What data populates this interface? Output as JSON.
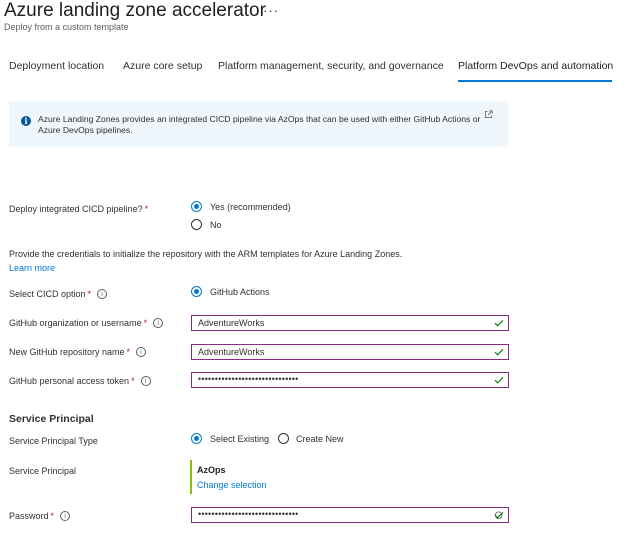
{
  "header": {
    "title": "Azure landing zone accelerator",
    "more_label": "···",
    "subtitle": "Deploy from a custom template"
  },
  "tabs": [
    {
      "label": "Deployment location",
      "active": false
    },
    {
      "label": "Azure core setup",
      "active": false
    },
    {
      "label": "Platform management, security, and governance",
      "active": false
    },
    {
      "label": "Platform DevOps and automation",
      "active": true
    }
  ],
  "info_banner": {
    "icon": "info-icon",
    "text": "Azure Landing Zones provides an integrated CICD pipeline via AzOps that can be used with either GitHub Actions or Azure DevOps pipelines.",
    "external_icon": "external-link-icon"
  },
  "deploy_cicd": {
    "label": "Deploy integrated CICD pipeline?",
    "required_mark": "*",
    "options": [
      {
        "label": "Yes (recommended)",
        "selected": true
      },
      {
        "label": "No",
        "selected": false
      }
    ]
  },
  "credentials": {
    "description": "Provide the credentials to initialize the repository with the ARM templates for Azure Landing Zones.",
    "learn_more": "Learn more"
  },
  "cicd_option": {
    "label": "Select CICD option",
    "required_mark": "*",
    "info_glyph": "i",
    "option": {
      "label": "GitHub Actions",
      "selected": true
    }
  },
  "github_org": {
    "label": "GitHub organization or username",
    "required_mark": "*",
    "info_glyph": "i",
    "value": "AdventureWorks",
    "valid": true
  },
  "github_repo": {
    "label": "New GitHub repository name",
    "required_mark": "*",
    "info_glyph": "i",
    "value": "AdventureWorks",
    "valid": true
  },
  "github_token": {
    "label": "GitHub personal access token",
    "required_mark": "*",
    "info_glyph": "i",
    "value": "••••••••••••••••••••••••••••••",
    "valid": true
  },
  "service_principal": {
    "section_title": "Service Principal",
    "type_label": "Service Principal Type",
    "type_options": [
      {
        "label": "Select Existing",
        "selected": true
      },
      {
        "label": "Create New",
        "selected": false
      }
    ],
    "sp_label": "Service Principal",
    "sp_name": "AzOps",
    "change_selection": "Change selection"
  },
  "password": {
    "label": "Password",
    "required_mark": "*",
    "info_glyph": "i",
    "value": "••••••••••••••••••••••••••••••",
    "valid": true
  },
  "colors": {
    "accent": "#0078d4",
    "required": "#a4262c",
    "valid_check": "#107c10",
    "input_border": "#8a2b8a",
    "info_bg": "#eff6fc",
    "sp_bar": "#8cbd18"
  }
}
